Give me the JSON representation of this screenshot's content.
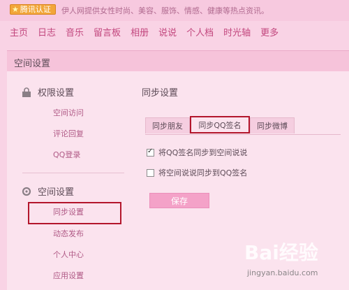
{
  "header": {
    "badge_label": "腾讯认证",
    "tagline": "伊人网提供女性时尚、美容、服饰、情感、健康等热点资讯。"
  },
  "nav": {
    "items": [
      "主页",
      "日志",
      "音乐",
      "留言板",
      "相册",
      "说说",
      "个人档",
      "时光轴",
      "更多"
    ]
  },
  "panel": {
    "title": "空间设置"
  },
  "sidebar": {
    "section1": {
      "title": "权限设置",
      "icon": "lock-icon",
      "items": [
        "空间访问",
        "评论回复",
        "QQ登录"
      ]
    },
    "section2": {
      "title": "空间设置",
      "icon": "gear-icon",
      "items": [
        "同步设置",
        "动态发布",
        "个人中心",
        "应用设置"
      ]
    }
  },
  "content": {
    "title": "同步设置",
    "tabs": [
      "同步朋友",
      "同步QQ签名",
      "同步微博"
    ],
    "active_tab": "同步QQ签名",
    "options": [
      {
        "label": "将QQ签名同步到空间说说",
        "checked": true
      },
      {
        "label": "将空间说说同步到QQ签名",
        "checked": false
      }
    ],
    "save_label": "保存"
  },
  "watermark": {
    "brand": "Bai经验",
    "url": "jingyan.baidu.com"
  },
  "colors": {
    "accent": "#c2477e",
    "highlight_border": "#b3162c",
    "save_button": "#f4a2c8"
  }
}
